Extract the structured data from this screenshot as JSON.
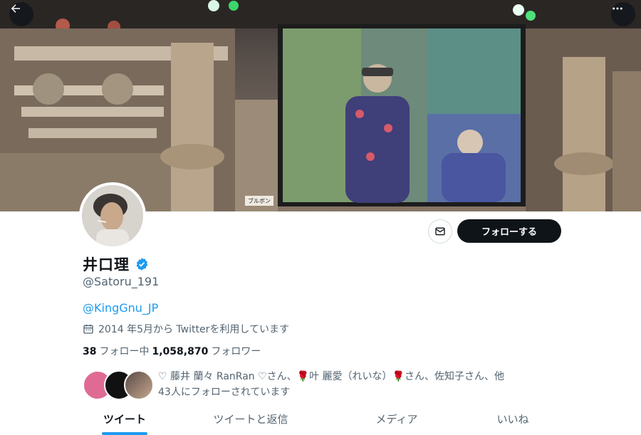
{
  "profile": {
    "display_name": "井口理",
    "handle": "@Satoru_191",
    "bio_link": "@KingGnu_JP",
    "joined": "2014 年5月から Twitterを利用しています"
  },
  "stats": {
    "following_count": "38",
    "following_label": "フォロー中",
    "followers_count": "1,058,870",
    "followers_label": "フォロワー"
  },
  "actions": {
    "follow_label": "フォローする"
  },
  "followers_you_know": {
    "line1": "♡ 藤井 蘭々 RanRan ♡さん、🌹叶 麗愛（れいな）🌹さん、佐知子さん、他",
    "line2": "43人にフォローされています"
  },
  "tabs": [
    {
      "label": "ツイート",
      "active": true
    },
    {
      "label": "ツイートと返信",
      "active": false
    },
    {
      "label": "メディア",
      "active": false
    },
    {
      "label": "いいね",
      "active": false
    }
  ],
  "banner_sign": "ブルボン",
  "icons": {
    "back": "arrow-left-icon",
    "more": "more-horizontal-icon",
    "message": "envelope-icon",
    "verified": "verified-badge-icon",
    "calendar": "calendar-icon"
  },
  "colors": {
    "accent": "#1d9bf0",
    "text_primary": "#0f1419",
    "text_secondary": "#536471",
    "follow_button": "#0f1419"
  }
}
